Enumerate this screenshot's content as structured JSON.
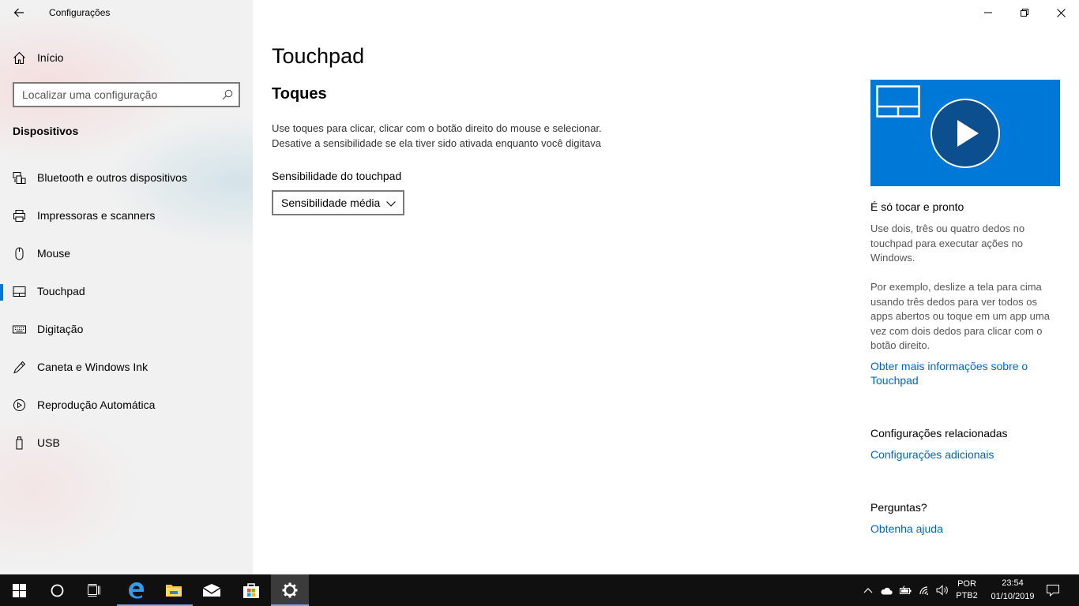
{
  "window": {
    "app_title": "Configurações",
    "controls": [
      "minimize",
      "restore",
      "close"
    ]
  },
  "sidebar": {
    "home_label": "Início",
    "search_placeholder": "Localizar uma configuração",
    "section_title": "Dispositivos",
    "items": [
      {
        "label": "Bluetooth e outros dispositivos",
        "icon": "bluetooth-devices-icon"
      },
      {
        "label": "Impressoras e scanners",
        "icon": "printer-icon"
      },
      {
        "label": "Mouse",
        "icon": "mouse-icon"
      },
      {
        "label": "Touchpad",
        "icon": "touchpad-icon",
        "selected": true
      },
      {
        "label": "Digitação",
        "icon": "keyboard-icon"
      },
      {
        "label": "Caneta e Windows Ink",
        "icon": "pen-icon"
      },
      {
        "label": "Reprodução Automática",
        "icon": "autoplay-icon"
      },
      {
        "label": "USB",
        "icon": "usb-icon"
      }
    ]
  },
  "main": {
    "page_title": "Touchpad",
    "section_title": "Toques",
    "description_line1": "Use toques para clicar, clicar com o botão direito do mouse e selecionar.",
    "description_line2": "Desative a sensibilidade se ela tiver sido ativada enquanto você digitava",
    "sensitivity_label": "Sensibilidade do touchpad",
    "sensitivity_value": "Sensibilidade média"
  },
  "aside": {
    "video_heading": "É só tocar e pronto",
    "video_text1": "Use dois, três ou quatro dedos no touchpad para executar ações no Windows.",
    "video_text2": "Por exemplo, deslize a tela para cima usando três dedos para ver todos os apps abertos ou toque em um app uma vez com dois dedos para clicar com o botão direito.",
    "more_info_link": "Obter mais informações sobre o Touchpad",
    "related_heading": "Configurações relacionadas",
    "related_link": "Configurações adicionais",
    "questions_heading": "Perguntas?",
    "help_link": "Obtenha ajuda"
  },
  "taskbar": {
    "apps": [
      "start-icon",
      "cortana-icon",
      "task-view-icon",
      "edge-icon",
      "file-explorer-icon",
      "mail-icon",
      "store-icon",
      "settings-icon"
    ],
    "active_app": "settings-icon",
    "language_line1": "POR",
    "language_line2": "PTB2",
    "time": "23:54",
    "date": "01/10/2019"
  },
  "colors": {
    "accent": "#0078d7",
    "link": "#0067c0",
    "taskbar": "#101010"
  }
}
